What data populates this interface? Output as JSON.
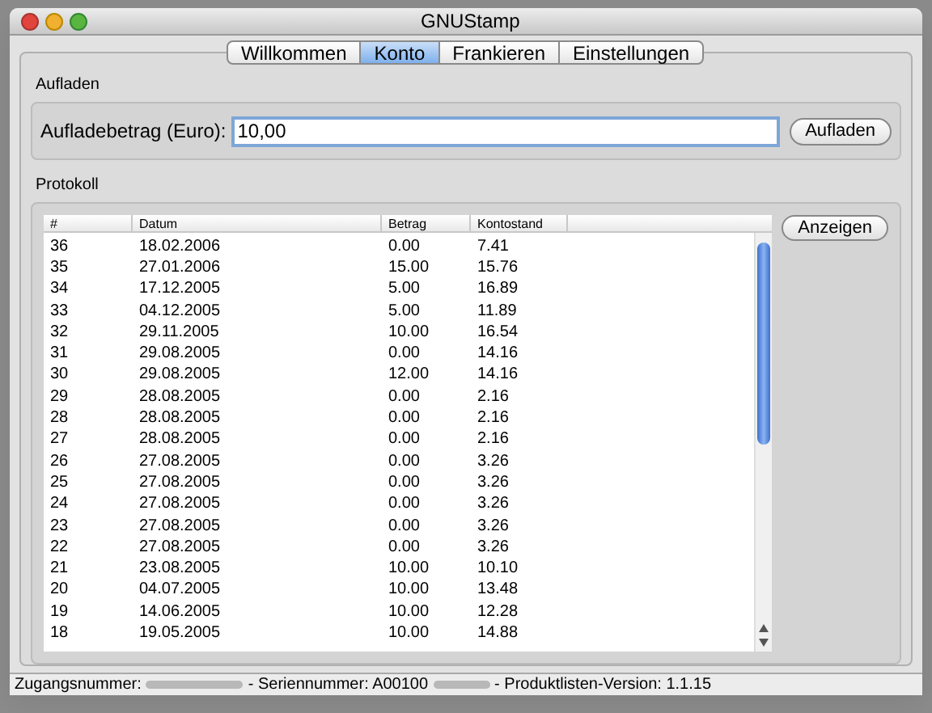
{
  "window": {
    "title": "GNUStamp"
  },
  "tabs": [
    {
      "label": "Willkommen",
      "selected": false
    },
    {
      "label": "Konto",
      "selected": true
    },
    {
      "label": "Frankieren",
      "selected": false
    },
    {
      "label": "Einstellungen",
      "selected": false
    }
  ],
  "recharge": {
    "group_label": "Aufladen",
    "field_label": "Aufladebetrag (Euro):",
    "value": "10,00",
    "button": "Aufladen"
  },
  "log": {
    "group_label": "Protokoll",
    "button": "Anzeigen",
    "columns": [
      "#",
      "Datum",
      "Betrag",
      "Kontostand"
    ],
    "rows": [
      [
        "36",
        "18.02.2006",
        "0.00",
        "7.41"
      ],
      [
        "35",
        "27.01.2006",
        "15.00",
        "15.76"
      ],
      [
        "34",
        "17.12.2005",
        "5.00",
        "16.89"
      ],
      [
        "33",
        "04.12.2005",
        "5.00",
        "11.89"
      ],
      [
        "32",
        "29.11.2005",
        "10.00",
        "16.54"
      ],
      [
        "31",
        "29.08.2005",
        "0.00",
        "14.16"
      ],
      [
        "30",
        "29.08.2005",
        "12.00",
        "14.16"
      ],
      [
        "29",
        "28.08.2005",
        "0.00",
        "2.16"
      ],
      [
        "28",
        "28.08.2005",
        "0.00",
        "2.16"
      ],
      [
        "27",
        "28.08.2005",
        "0.00",
        "2.16"
      ],
      [
        "26",
        "27.08.2005",
        "0.00",
        "3.26"
      ],
      [
        "25",
        "27.08.2005",
        "0.00",
        "3.26"
      ],
      [
        "24",
        "27.08.2005",
        "0.00",
        "3.26"
      ],
      [
        "23",
        "27.08.2005",
        "0.00",
        "3.26"
      ],
      [
        "22",
        "27.08.2005",
        "0.00",
        "3.26"
      ],
      [
        "21",
        "23.08.2005",
        "10.00",
        "10.10"
      ],
      [
        "20",
        "04.07.2005",
        "10.00",
        "13.48"
      ],
      [
        "19",
        "14.06.2005",
        "10.00",
        "12.28"
      ],
      [
        "18",
        "19.05.2005",
        "10.00",
        "14.88"
      ]
    ]
  },
  "status_bar": {
    "access_label": "Zugangsnummer:",
    "serial_label": "- Seriennummer: A00100",
    "version": "- Produktlisten-Version: 1.1.15"
  }
}
